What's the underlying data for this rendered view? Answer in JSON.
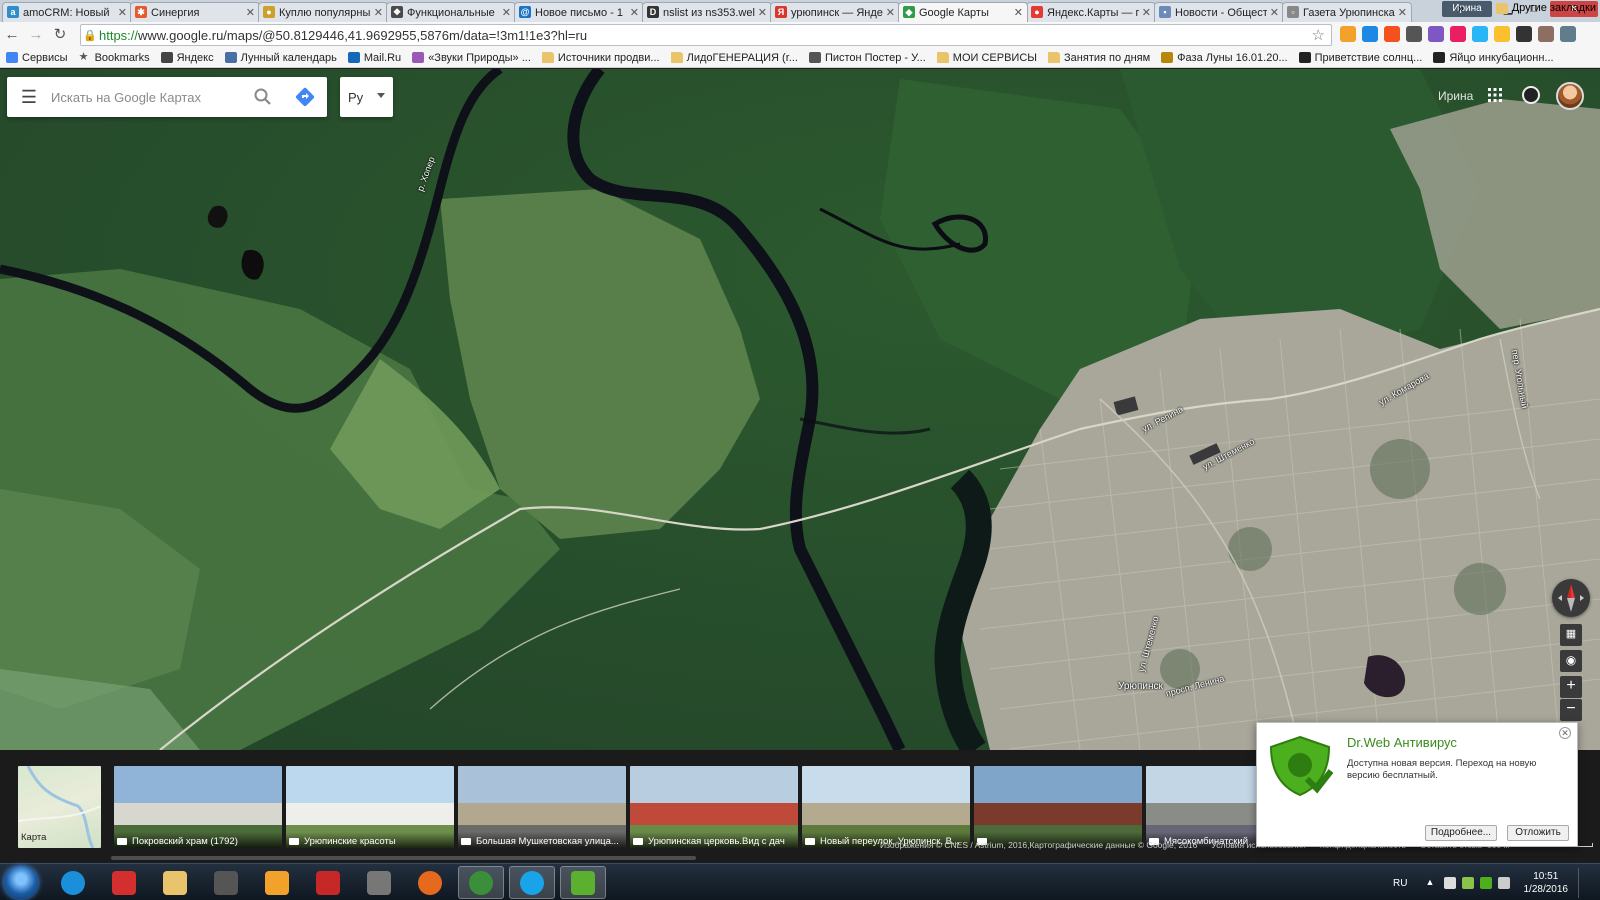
{
  "browser": {
    "tabs": [
      {
        "label": "amoCRM: Новый",
        "color": "#2d8ec9",
        "glyph": "a"
      },
      {
        "label": "Синергия",
        "color": "#e45a2a",
        "glyph": "✱"
      },
      {
        "label": "Куплю популярны",
        "color": "#caa12a",
        "glyph": "●"
      },
      {
        "label": "Функциональные",
        "color": "#4a4a4a",
        "glyph": "❖"
      },
      {
        "label": "Новое письмо - 1",
        "color": "#1b74c7",
        "glyph": "@"
      },
      {
        "label": "nslist из ns353.wel",
        "color": "#333",
        "glyph": "D"
      },
      {
        "label": "урюпинск — Янде",
        "color": "#d9372b",
        "glyph": "Я"
      },
      {
        "label": "Google Карты",
        "color": "#2f9c4a",
        "glyph": "◆",
        "active": true
      },
      {
        "label": "Яндекс.Карты — п",
        "color": "#e53935",
        "glyph": "●"
      },
      {
        "label": "Новости - Общест",
        "color": "#6b8ab8",
        "glyph": "▪"
      },
      {
        "label": "Газета Урюпинска",
        "color": "#888",
        "glyph": "▫"
      }
    ],
    "user_chip": "Ирина",
    "url_scheme": "https://",
    "url_rest": "www.google.ru/maps/@50.8129446,41.9692955,5876m/data=!3m1!1e3?hl=ru",
    "bookmarks": [
      {
        "label": "Сервисы",
        "color": "#4285f4"
      },
      {
        "label": "Bookmarks",
        "color": "#555",
        "star": true
      },
      {
        "label": "Яндекс",
        "color": "#444"
      },
      {
        "label": "Лунный календарь",
        "color": "#4a6fa5"
      },
      {
        "label": "Mail.Ru",
        "color": "#1468b8"
      },
      {
        "label": "«Звуки Природы» ...",
        "color": "#9b59b6"
      },
      {
        "label": "Источники продви...",
        "folder": true
      },
      {
        "label": "ЛидоГЕНЕРАЦИЯ (r...",
        "folder": true
      },
      {
        "label": "Пистон Постер - У...",
        "color": "#555"
      },
      {
        "label": "МОИ СЕРВИСЫ",
        "folder": true
      },
      {
        "label": "Занятия по дням",
        "folder": true
      },
      {
        "label": "Фаза Луны 16.01.20...",
        "color": "#b8860b"
      },
      {
        "label": "Приветствие солнц...",
        "color": "#222"
      },
      {
        "label": "Яйцо инкубационн...",
        "color": "#222"
      }
    ],
    "bookmarks_more": "»",
    "bookmarks_other": "Другие закладки"
  },
  "maps": {
    "search_placeholder": "Искать на Google Картах",
    "language": "Ру",
    "account_name": "Ирина",
    "labels": {
      "river": "р. Хопер",
      "street1": "ул. Репина",
      "street2": "ул. Штеменко",
      "street3": "ул. Комарова",
      "street4": "пер. Угольный",
      "street5": "ул. Штеменко",
      "street6": "просп. Ленина",
      "city": "Урюпинск"
    },
    "map_thumb_label": "Карта",
    "photos": [
      {
        "caption": "Покровский храм (1792)",
        "type": "photo",
        "c1": "#8fb4d8",
        "c2": "#d7d7cf",
        "c3": "#4c6b3a"
      },
      {
        "caption": "Урюпинские красоты",
        "type": "photo",
        "c1": "#bcd8ee",
        "c2": "#eeeeea",
        "c3": "#6e8f4c"
      },
      {
        "caption": "Большая Мушкетовская улица...",
        "type": "street",
        "c1": "#a9c2d9",
        "c2": "#b2a890",
        "c3": "#6a6a66"
      },
      {
        "caption": "Урюпинская церковь.Вид с дач",
        "type": "photo",
        "c1": "#b9cde0",
        "c2": "#c04a3a",
        "c3": "#6a8a4a"
      },
      {
        "caption": "Новый переулок, Урюпинск, В...",
        "type": "street",
        "c1": "#c9dcec",
        "c2": "#b3aa90",
        "c3": "#5d7a3c"
      },
      {
        "caption": "",
        "type": "photo",
        "c1": "#7fa6c9",
        "c2": "#7a3a2c",
        "c3": "#4d6a3a"
      },
      {
        "caption": "Мясокомбинатский",
        "type": "street",
        "c1": "#c2d6e6",
        "c2": "#8a8d86",
        "c3": "#667"
      }
    ],
    "legal": [
      "Изображения © CNES / Astrium, 2016,Картографические данные © Google, 2016",
      "Условия использования",
      "Конфиденциальность",
      "Оставить отзыв"
    ],
    "scale_label": "500 м"
  },
  "popup": {
    "title": "Dr.Web Антивирус",
    "message": "Доступна новая версия. Переход на новую версию бесплатный.",
    "more_button": "Подробнее...",
    "later_button": "Отложить"
  },
  "taskbar": {
    "apps": [
      {
        "name": "ie",
        "color": "#1b8fd9"
      },
      {
        "name": "mail",
        "color": "#d32f2f"
      },
      {
        "name": "explorer",
        "color": "#e9c46a"
      },
      {
        "name": "websurf",
        "color": "#555"
      },
      {
        "name": "media",
        "color": "#f2a22a"
      },
      {
        "name": "rs",
        "color": "#c62828"
      },
      {
        "name": "app",
        "color": "#777"
      },
      {
        "name": "firefox",
        "color": "#e66a1e"
      },
      {
        "name": "chrome",
        "color": "#3c8f3a",
        "active": true
      },
      {
        "name": "skype",
        "color": "#1aa3e8",
        "active": true
      },
      {
        "name": "evernote",
        "color": "#5cb030",
        "active": true
      }
    ],
    "lang": "RU",
    "time": "10:51",
    "date": "1/28/2016"
  }
}
